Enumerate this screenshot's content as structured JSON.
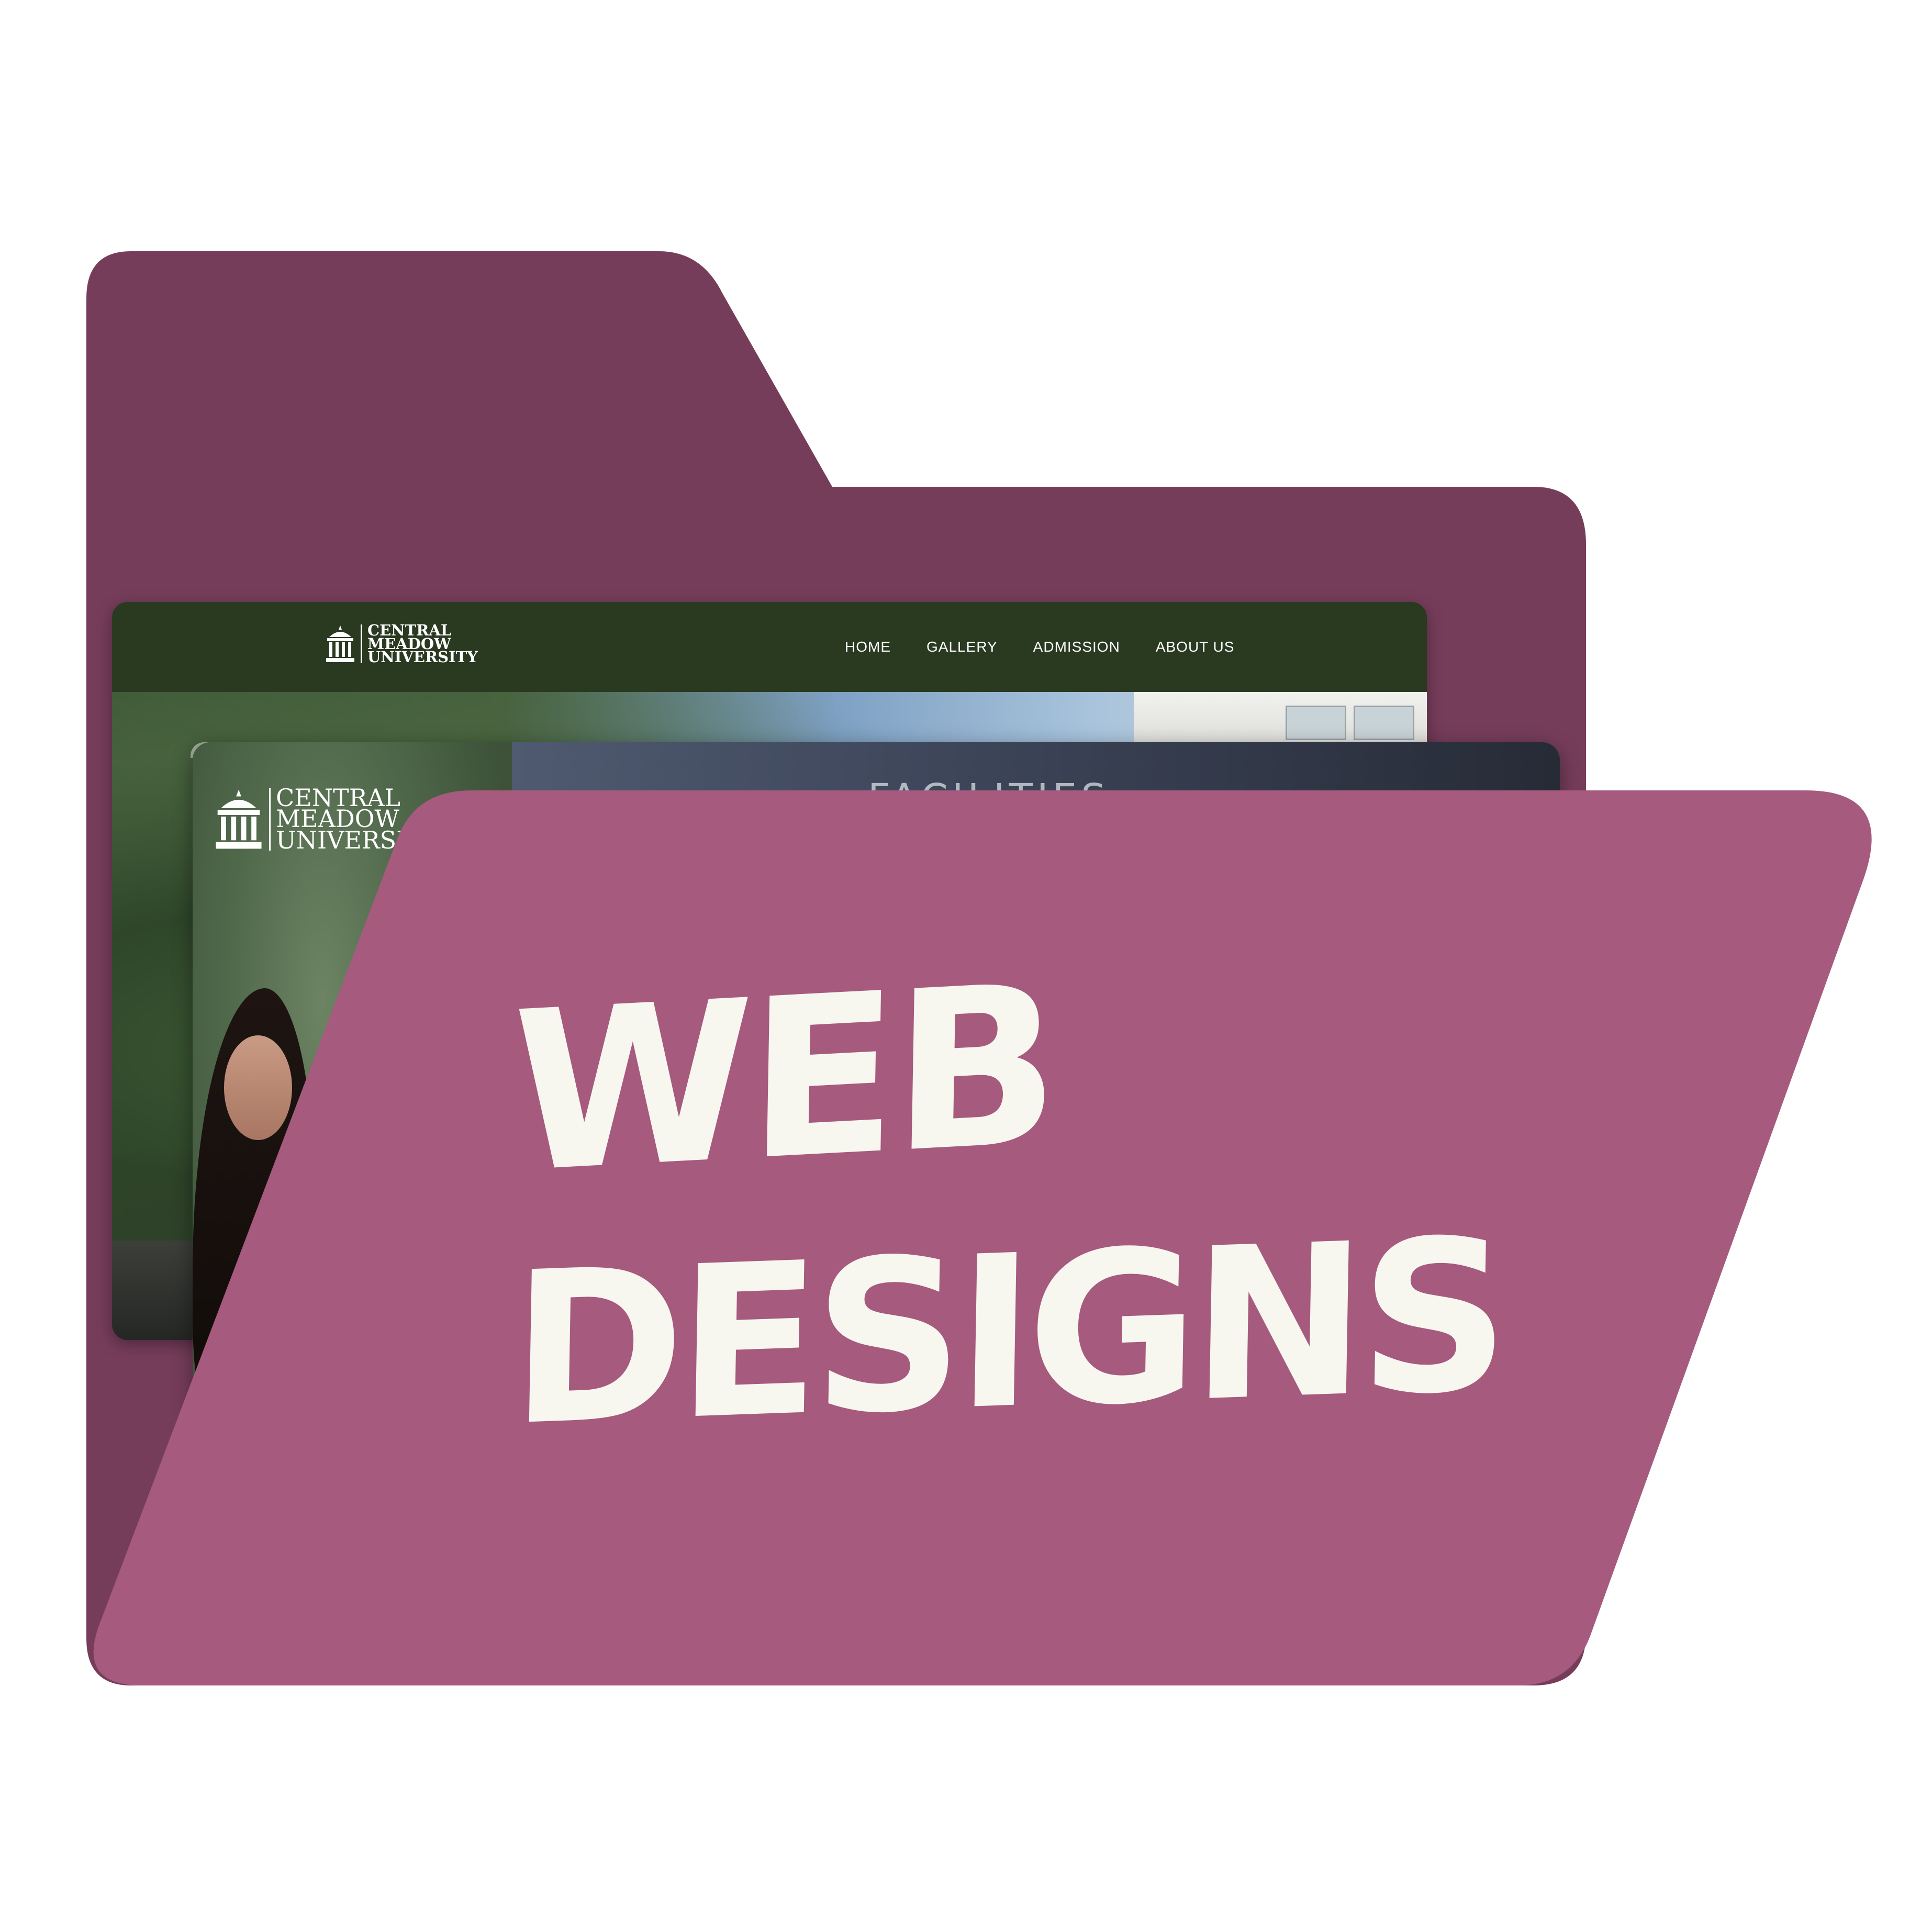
{
  "colors": {
    "folder_back": "#763d5b",
    "folder_front": "#a55a7e",
    "lettering": "#f7f6ef",
    "nav_green": "#2a3a21",
    "panel_slate": "#3c4458"
  },
  "card_back": {
    "logo": {
      "icon": "university-building-icon",
      "line1": "CENTRAL",
      "line2": "MEADOW",
      "line3": "UNIVERSITY"
    },
    "nav": {
      "home": "HOME",
      "gallery": "GALLERY",
      "admission": "ADMISSION",
      "about": "ABOUT US"
    }
  },
  "card_front": {
    "logo": {
      "icon": "university-building-icon",
      "line1": "CENTRAL",
      "line2": "MEADOW",
      "line3": "UNIVERSITY"
    },
    "section_title": "FACILITIES"
  },
  "headline": {
    "line1": "WEB",
    "line2": "DESIGNS"
  }
}
